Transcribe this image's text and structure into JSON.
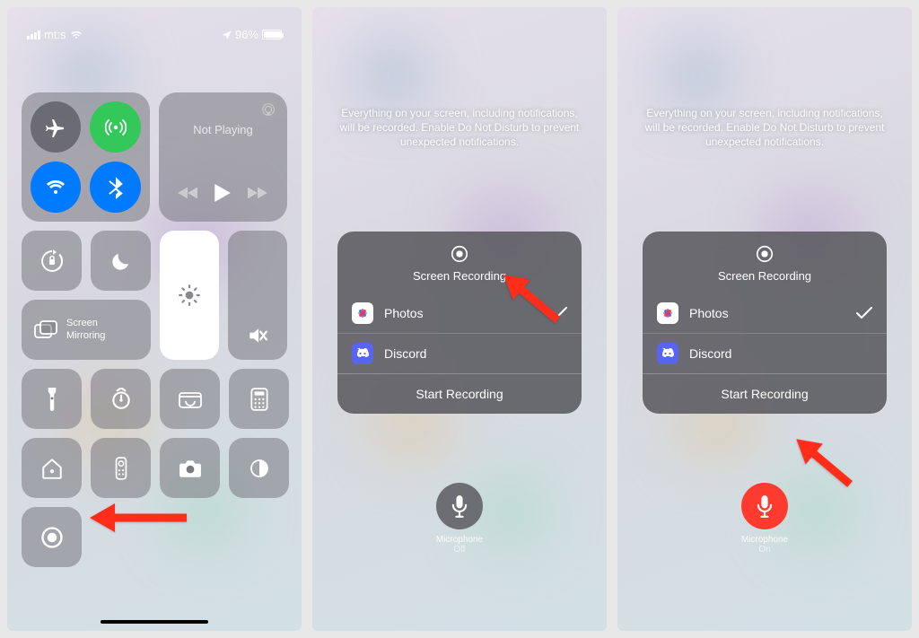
{
  "status": {
    "carrier": "mt:s",
    "battery": "96%"
  },
  "controlCenter": {
    "media": {
      "title": "Not Playing"
    },
    "mirror": {
      "line1": "Screen",
      "line2": "Mirroring"
    }
  },
  "hint": "Everything on your screen, including notifications, will be recorded. Enable Do Not Disturb to prevent unexpected notifications.",
  "sheet": {
    "title": "Screen Recording",
    "apps": [
      {
        "name": "Photos",
        "selected": true
      },
      {
        "name": "Discord",
        "selected": false
      }
    ],
    "start": "Start Recording"
  },
  "mic": {
    "label": "Microphone",
    "off": "Off",
    "on": "On"
  }
}
